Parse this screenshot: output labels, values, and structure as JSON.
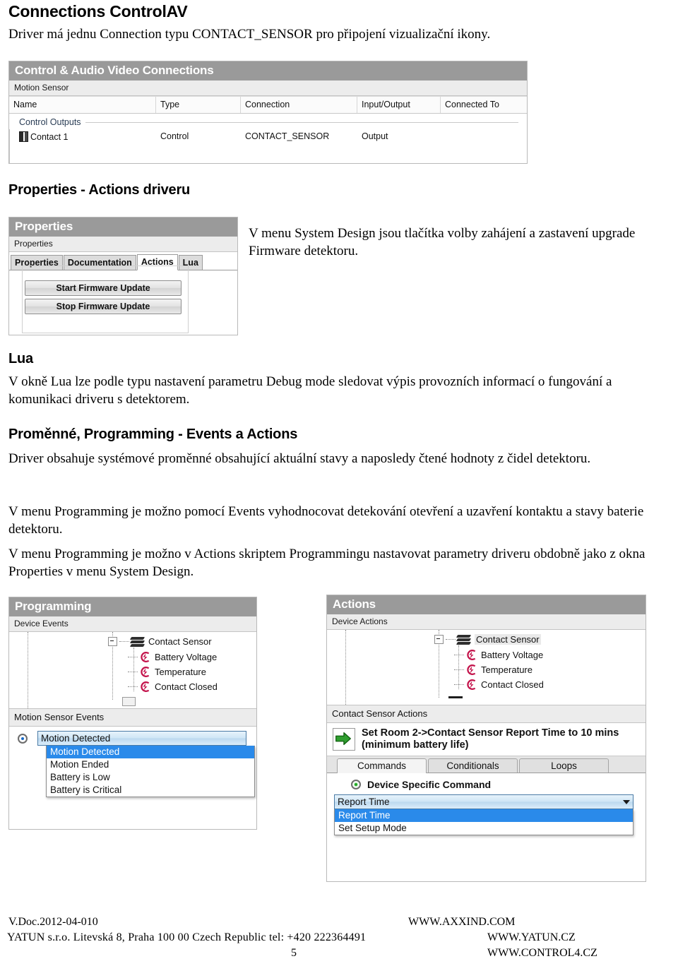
{
  "doc": {
    "section1_heading": "Connections ControlAV",
    "section1_paragraph": "Driver má jednu Connection typu CONTACT_SENSOR pro připojení vizualizační ikony.",
    "section2_heading": "Properties - Actions driveru",
    "section2_paragraph": "V menu System Design jsou tlačítka volby zahájení a zastavení upgrade Firmware detektoru.",
    "section3_heading": "Lua",
    "section3_paragraph": "V okně Lua lze podle typu nastavení parametru Debug mode sledovat výpis provozních informací o fungování a komunikaci driveru s detektorem.",
    "section4_heading": "Proměnné, Programming  - Events a Actions",
    "section4_paragraph1": "Driver obsahuje systémové proměnné obsahující aktuální stavy a naposledy čtené hodnoty z čidel detektoru.",
    "section4_paragraph2": "V menu Programming je možno pomocí Events vyhodnocovat detekování otevření a uzavření kontaktu a stavy baterie detektoru.",
    "section4_paragraph3": "V menu Programming je možno v Actions skriptem Programmingu nastavovat parametry driveru obdobně jako z okna Properties v menu System Design."
  },
  "connections_panel": {
    "title": "Control & Audio Video Connections",
    "subtitle": "Motion Sensor",
    "columns": [
      "Name",
      "Type",
      "Connection",
      "Input/Output",
      "Connected To"
    ],
    "group_label": "Control Outputs",
    "row": {
      "name": "Contact 1",
      "type": "Control",
      "connection": "CONTACT_SENSOR",
      "input_output": "Output",
      "connected_to": ""
    }
  },
  "properties_panel": {
    "title": "Properties",
    "subtitle": "Properties",
    "tabs": [
      {
        "label": "Properties",
        "active": false
      },
      {
        "label": "Documentation",
        "active": false
      },
      {
        "label": "Actions",
        "active": true
      },
      {
        "label": "Lua",
        "active": false
      }
    ],
    "buttons": [
      {
        "label": "Start Firmware Update"
      },
      {
        "label": "Stop Firmware Update"
      }
    ]
  },
  "programming_panel": {
    "title": "Programming",
    "subtitle": "Device Events",
    "tree": {
      "root": "Contact Sensor",
      "children": [
        "Battery Voltage",
        "Temperature",
        "Contact Closed"
      ]
    },
    "events_subtitle": "Motion Sensor Events",
    "combo_value": "Motion Detected",
    "options": [
      {
        "label": "Motion Detected",
        "selected": true
      },
      {
        "label": "Motion Ended",
        "selected": false
      },
      {
        "label": "Battery is Low",
        "selected": false
      },
      {
        "label": "Battery is Critical",
        "selected": false
      }
    ]
  },
  "actions_panel": {
    "title": "Actions",
    "subtitle": "Device Actions",
    "tree": {
      "root": "Contact Sensor",
      "children": [
        "Battery Voltage",
        "Temperature",
        "Contact Closed"
      ]
    },
    "actions_subtitle": "Contact Sensor Actions",
    "action_text": "Set Room 2->Contact Sensor Report Time to 10 mins (minimum battery life)",
    "tabs": [
      {
        "label": "Commands",
        "active": true
      },
      {
        "label": "Conditionals",
        "active": false
      },
      {
        "label": "Loops",
        "active": false
      }
    ],
    "radio_label": "Device Specific Command",
    "combo_value": "Report Time",
    "options": [
      {
        "label": "Report Time",
        "selected": true
      },
      {
        "label": "Set Setup Mode",
        "selected": false
      }
    ]
  },
  "footer": {
    "doc_version": "V.Doc.2012-04-010",
    "site_primary": "WWW.AXXIND.COM",
    "company_line": "YATUN s.r.o.    Litevská 8,    Praha     100 00  Czech Republic  tel: +420  222364491",
    "site_yatun": "WWW.YATUN.CZ",
    "site_control4": "WWW.CONTROL4.CZ",
    "page_number": "5"
  },
  "colors": {
    "panel_title_bg": "#9a9a9a",
    "panel_sub_bg": "#ececec",
    "selection_blue": "#2a8aea",
    "bolt_red": "#c3124a",
    "arrow_green": "#2f9e2f",
    "group_label": "#2a3d55"
  }
}
